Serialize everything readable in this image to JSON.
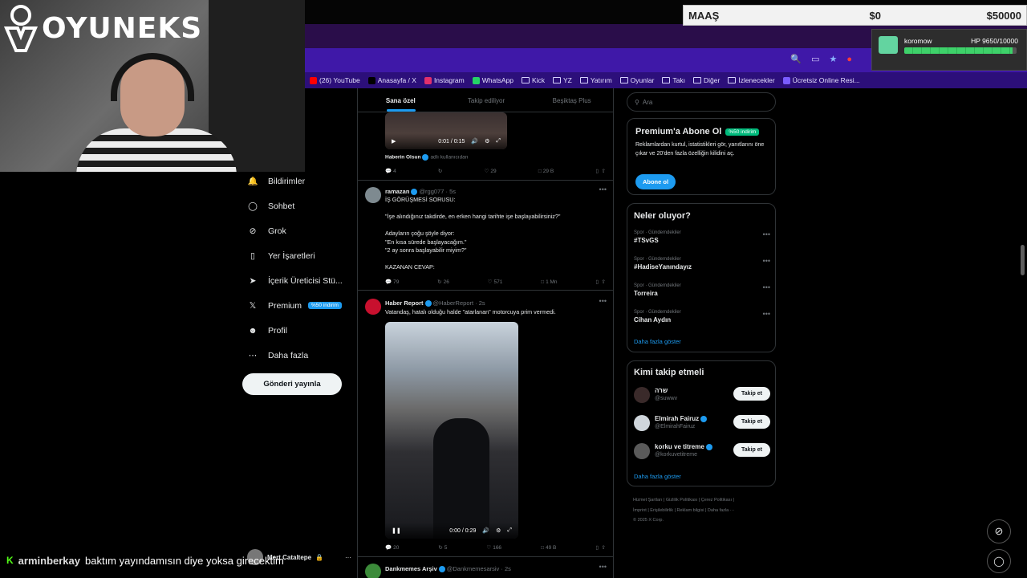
{
  "stream": {
    "logo_text": "OYUNEKS",
    "salary": {
      "label": "MAAŞ",
      "current": "$0",
      "max": "$50000"
    },
    "hp": {
      "name": "koromow",
      "text": "HP 9650/10000",
      "fraction": 0.965
    },
    "chat": {
      "user": "arminberkay",
      "message": "baktım yayındamısın diye yoksa girecektim"
    }
  },
  "browser": {
    "bookmarks": [
      {
        "label": "(26) YouTube",
        "color": "#ff0000"
      },
      {
        "label": "Anasayfa / X",
        "color": "#000000"
      },
      {
        "label": "Instagram",
        "color": "#e1306c"
      },
      {
        "label": "WhatsApp",
        "color": "#25d366"
      },
      {
        "label": "Kick",
        "folder": true
      },
      {
        "label": "YZ",
        "folder": true
      },
      {
        "label": "Yatırım",
        "folder": true
      },
      {
        "label": "Oyunlar",
        "folder": true
      },
      {
        "label": "Takı",
        "folder": true
      },
      {
        "label": "Diğer",
        "folder": true
      },
      {
        "label": "İzlenecekler",
        "folder": true
      },
      {
        "label": "Ücretsiz Online Resi...",
        "color": "#7a5cff",
        "prefix": "RP"
      }
    ]
  },
  "nav": {
    "items": [
      {
        "label": "Bildirimler",
        "icon": "bell-icon"
      },
      {
        "label": "Sohbet",
        "icon": "chat-icon"
      },
      {
        "label": "Grok",
        "icon": "grok-icon"
      },
      {
        "label": "Yer İşaretleri",
        "icon": "bookmark-icon"
      },
      {
        "label": "İçerik Üreticisi Stü...",
        "icon": "rocket-icon"
      },
      {
        "label": "Premium",
        "icon": "x-logo-icon",
        "badge": "%50 indirim"
      },
      {
        "label": "Profil",
        "icon": "profile-icon"
      },
      {
        "label": "Daha fazla",
        "icon": "more-icon"
      }
    ],
    "post_button": "Gönderi yayınla",
    "account": "Mert Cataltepe",
    "account_more": "···"
  },
  "timeline": {
    "tabs": [
      "Sana özel",
      "Takip ediliyor",
      "Beşiktaş Plus"
    ],
    "tweet0": {
      "video_time": "0:01 / 0:15",
      "source": "Haberin Olsun",
      "source_sub": "adlı kullanıcıdan",
      "replies": "4",
      "reposts": "",
      "likes": "29",
      "views": "29 B"
    },
    "tweet1": {
      "name": "ramazan",
      "handle": "@rgg077 · 5s",
      "body": "İŞ GÖRÜŞMESİ SORUSU:\n\n\"İşe alındığınız takdirde, en erken hangi tarihte işe başlayabilirsiniz?\"\n\nAdayların çoğu şöyle diyor:\n\"En kısa sürede başlayacağım.\"\n\"2 ay sonra başlayabilir miyim?\"\n\nKAZANAN CEVAP:",
      "replies": "79",
      "reposts": "26",
      "likes": "571",
      "views": "1 Mn"
    },
    "tweet2": {
      "name": "Haber Report",
      "handle": "@HaberReport · 2s",
      "body": "Vatandaş, hatalı olduğu halde \"atarlanan\" motorcuya prim vermedi.",
      "video_time": "0:00 / 0:29",
      "replies": "20",
      "reposts": "5",
      "likes": "166",
      "views": "49 B"
    },
    "tweet3": {
      "name": "Dankmemes Arşiv",
      "handle": "@Dankmemesarsiv · 2s"
    }
  },
  "sidebar": {
    "search_placeholder": "Ara",
    "premium": {
      "title": "Premium'a Abone Ol",
      "badge": "%50 indirim",
      "text": "Reklamlardan kurtul, istatistikleri gör, yanıtlarını öne çıkar ve 20'den fazla özelliğin kilidini aç.",
      "button": "Abone ol"
    },
    "trends": {
      "title": "Neler oluyor?",
      "items": [
        {
          "category": "Spor · Gündemdekiler",
          "name": "#TSvGS"
        },
        {
          "category": "Spor · Gündemdekiler",
          "name": "#HadiseYanındayız"
        },
        {
          "category": "Spor · Gündemdekiler",
          "name": "Torreira"
        },
        {
          "category": "Spor · Gündemdekiler",
          "name": "Cihan Aydın"
        }
      ],
      "more": "Daha fazla göster"
    },
    "follow": {
      "title": "Kimi takip etmeli",
      "items": [
        {
          "name": "שרה",
          "handle": "@suwwv",
          "verified": false
        },
        {
          "name": "Elmirah Fairuz",
          "handle": "@ElmirahFairuz",
          "verified": true
        },
        {
          "name": "korku ve titreme",
          "handle": "@korkuvetitreme",
          "verified": true
        }
      ],
      "button": "Takip et",
      "more": "Daha fazla göster"
    },
    "footer": {
      "line1": "Hizmet Şartları  |  Gizlilik Politikası  |  Çerez Politikası  |",
      "line2": "İmprint  |  Erişilebilirlik  |  Reklam bilgisi  |  Daha fazla ···",
      "line3": "© 2025 X Corp."
    }
  }
}
